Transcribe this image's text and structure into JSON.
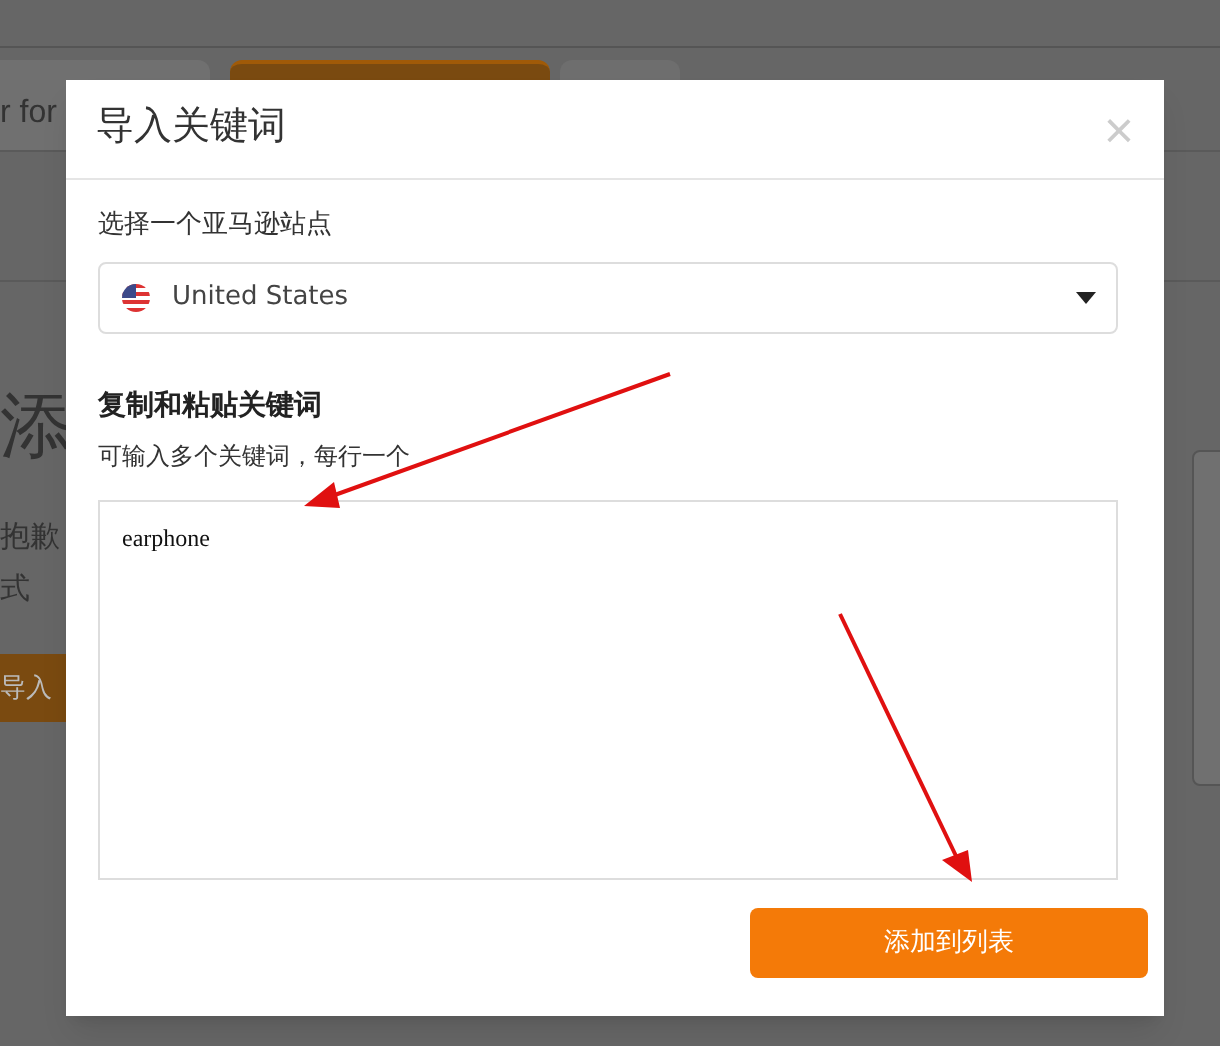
{
  "background": {
    "tab_text": "r for",
    "heading": "添",
    "line_1": "抱歉",
    "line_2": "式",
    "button": "导入"
  },
  "dialog": {
    "title": "导入关键词",
    "close": "×",
    "site_label": "选择一个亚马逊站点",
    "site_select": {
      "value": "United States"
    },
    "section_title": "复制和粘贴关键词",
    "hint": "可输入多个关键词，每行一个",
    "keywords_field": {
      "value": "earphone"
    },
    "submit": "添加到列表"
  }
}
